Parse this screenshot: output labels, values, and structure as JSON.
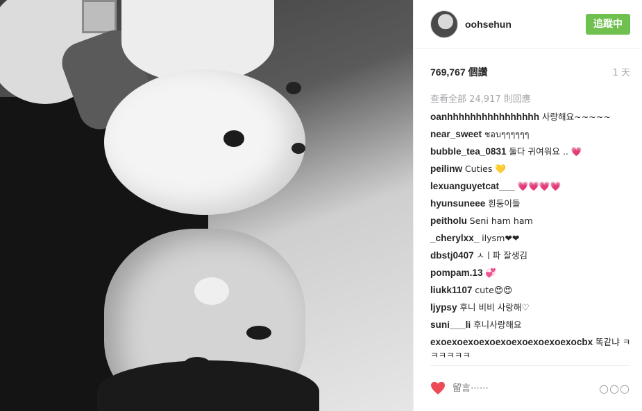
{
  "header": {
    "username": "oohsehun",
    "follow_label": "追蹤中"
  },
  "meta": {
    "likes": "769,767 個讚",
    "age": "1 天"
  },
  "comments": {
    "view_all": "查看全部 24,917 則回應",
    "items": [
      {
        "user": "oanhhhhhhhhhhhhhhhh",
        "text": "사랑해요~~~~~"
      },
      {
        "user": "near_sweet",
        "text": "ชอบๆๆๆๆๆๆ"
      },
      {
        "user": "bubble_tea_0831",
        "text": "둘다 귀여워요 .. 💗"
      },
      {
        "user": "peilinw",
        "text": "Cuties 💛"
      },
      {
        "user": "lexuanguyetcat___",
        "text": "💗💗💗💗"
      },
      {
        "user": "hyunsuneee",
        "text": "흰둥이들"
      },
      {
        "user": "peitholu",
        "text": "Seni ham ham"
      },
      {
        "user": "_cherylxx_",
        "text": "ilysm❤❤"
      },
      {
        "user": "dbstj0407",
        "text": "ㅅㅣ파 잘생김"
      },
      {
        "user": "pompam.13",
        "text": "💞"
      },
      {
        "user": "liukk1107",
        "text": "cute😍😍"
      },
      {
        "user": "ljypsy",
        "text": "후니 비비 사랑해♡"
      },
      {
        "user": "suni___li",
        "text": "후니사랑해요"
      },
      {
        "user": "exoexoexoexoexoexoexoexoexocbx",
        "text": "똑같냐 ㅋㅋㅋㅋㅋㅋ"
      }
    ]
  },
  "footer": {
    "placeholder": "留言⋯⋯",
    "more": "○○○"
  },
  "colors": {
    "follow": "#70c050",
    "heart": "#ed4956",
    "muted": "#a5a7aa"
  }
}
